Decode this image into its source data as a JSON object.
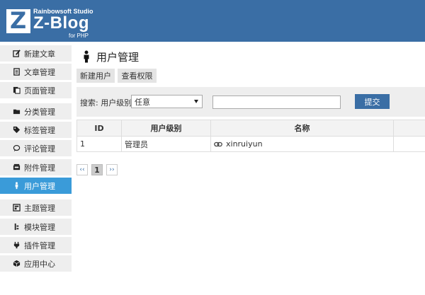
{
  "brand": {
    "studio": "Rainbowsoft Studio",
    "name": "Z-Blog",
    "sub": "for PHP",
    "color": "#3a6ea5"
  },
  "sidebar": {
    "items": [
      {
        "label": "新建文章",
        "icon": "edit-icon"
      },
      {
        "label": "文章管理",
        "icon": "article-icon"
      },
      {
        "label": "页面管理",
        "icon": "page-icon"
      },
      {
        "label": "分类管理",
        "icon": "folder-icon"
      },
      {
        "label": "标签管理",
        "icon": "tag-icon"
      },
      {
        "label": "评论管理",
        "icon": "comment-icon"
      },
      {
        "label": "附件管理",
        "icon": "attachment-icon"
      },
      {
        "label": "用户管理",
        "icon": "user-icon",
        "active": true
      },
      {
        "label": "主题管理",
        "icon": "theme-icon"
      },
      {
        "label": "模块管理",
        "icon": "module-icon"
      },
      {
        "label": "插件管理",
        "icon": "plugin-icon"
      },
      {
        "label": "应用中心",
        "icon": "app-center-icon"
      }
    ],
    "active_color": "#3a9bd9"
  },
  "main": {
    "title": "用户管理",
    "buttons": {
      "new_user": "新建用户",
      "view_permissions": "查看权限"
    },
    "search": {
      "label": "搜索:  用户级别",
      "level_value": "任意",
      "input_value": "",
      "submit": "提交"
    },
    "table": {
      "headers": [
        "ID",
        "用户级别",
        "名称",
        ""
      ],
      "rows": [
        {
          "id": "1",
          "level": "管理员",
          "name": "xinruiyun"
        }
      ]
    },
    "pagination": {
      "prev": "‹‹",
      "current": "1",
      "next": "››"
    }
  }
}
